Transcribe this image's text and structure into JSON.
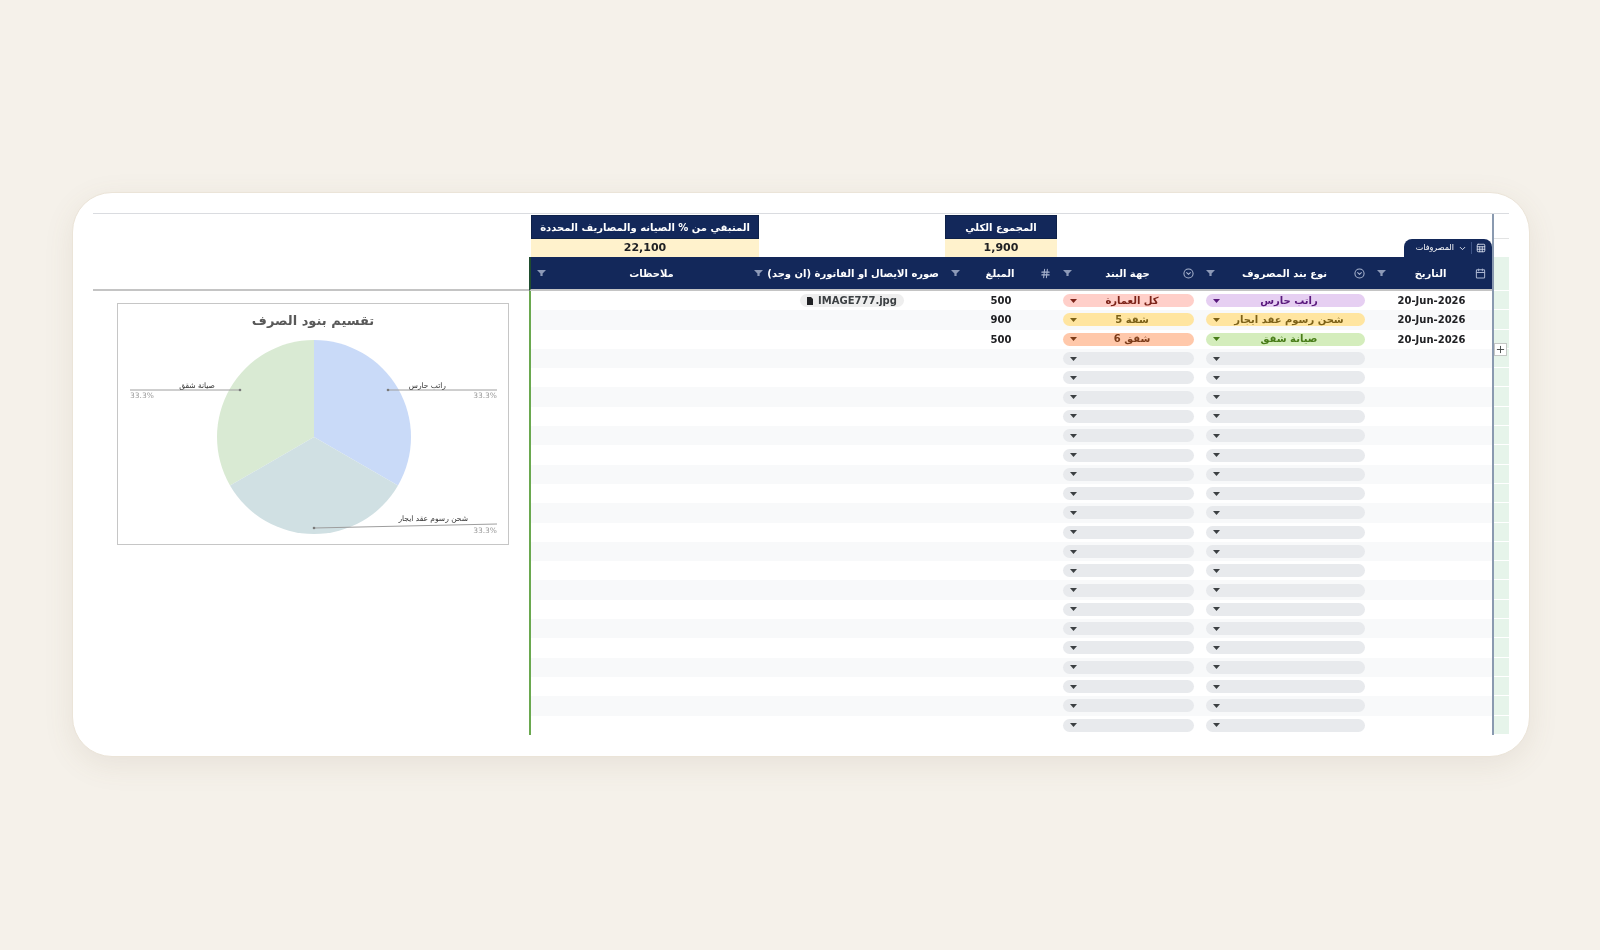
{
  "sheet_tab": {
    "label": "المصروفات"
  },
  "summary": [
    {
      "kind": "total",
      "label": "المجموع الكلي",
      "value": "1,900"
    },
    {
      "kind": "remaining",
      "label": "المتبقي من % الصيانه والمصاريف المحددة",
      "value": "22,100"
    }
  ],
  "table": {
    "columns": [
      {
        "title": "التاريخ",
        "kind": "date"
      },
      {
        "title": "نوع بند المصروف",
        "kind": "dropdown"
      },
      {
        "title": "جهة البند",
        "kind": "dropdown"
      },
      {
        "title": "المبلغ",
        "kind": "number"
      },
      {
        "title": "صوره الايصال او الفاتورة (ان وجد)",
        "kind": "file"
      },
      {
        "title": "ملاحظات",
        "kind": "text"
      }
    ],
    "rows": [
      {
        "kind": "entry",
        "date": "20-Jun-2026",
        "type": {
          "label": "راتب حارس",
          "color": "#e6cff2"
        },
        "party": {
          "label": "كل العمارة",
          "color": "#ffcfc9"
        },
        "amount": "500",
        "receipt": "IMAGE777.jpg"
      },
      {
        "kind": "entry",
        "date": "20-Jun-2026",
        "type": {
          "label": "شحن رسوم عقد ايجار",
          "color": "#ffe5a0"
        },
        "party": {
          "label": "شقة 5",
          "color": "#ffe5a0"
        },
        "amount": "900"
      },
      {
        "kind": "entry",
        "date": "20-Jun-2026",
        "type": {
          "label": "صيانة شقق",
          "color": "#d4edbc"
        },
        "party": {
          "label": "شقق 6",
          "color": "#ffc8aa"
        },
        "amount": "500"
      },
      {
        "kind": "blank"
      },
      {
        "kind": "blank"
      },
      {
        "kind": "blank"
      },
      {
        "kind": "blank"
      },
      {
        "kind": "blank"
      },
      {
        "kind": "blank"
      },
      {
        "kind": "blank"
      },
      {
        "kind": "blank"
      },
      {
        "kind": "blank"
      },
      {
        "kind": "blank"
      },
      {
        "kind": "blank"
      },
      {
        "kind": "blank"
      },
      {
        "kind": "blank"
      },
      {
        "kind": "blank"
      },
      {
        "kind": "blank"
      },
      {
        "kind": "blank"
      },
      {
        "kind": "blank"
      },
      {
        "kind": "blank"
      },
      {
        "kind": "blank"
      },
      {
        "kind": "blank"
      }
    ]
  },
  "chart": {
    "chart_data": {
      "type": "pie",
      "title": "تقسيم بنود الصرف",
      "categories": [
        "راتب حارس",
        "صيانة شقق",
        "شحن رسوم عقد ايجار"
      ],
      "values": [
        33.3,
        33.3,
        33.3
      ],
      "colors": [
        "#c9daf8",
        "#d9ead3",
        "#d0e0e3"
      ],
      "value_labels": [
        "33.3%",
        "33.3%",
        "33.3%"
      ]
    }
  }
}
